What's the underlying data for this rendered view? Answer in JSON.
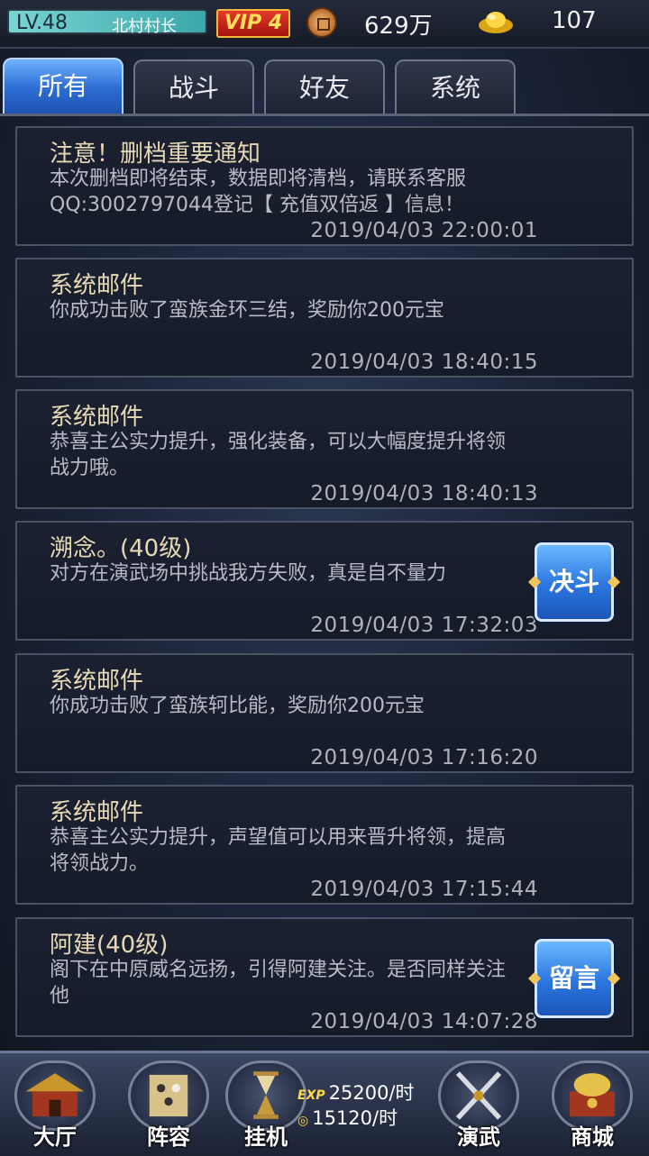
{
  "status_bar": {
    "level": "LV.48",
    "title": "北村村长",
    "vip": "VIP 4",
    "coins": "629万",
    "ingots": "107"
  },
  "tabs": [
    {
      "label": "所有",
      "active": true
    },
    {
      "label": "战斗",
      "active": false
    },
    {
      "label": "好友",
      "active": false
    },
    {
      "label": "系统",
      "active": false
    }
  ],
  "mails": [
    {
      "title": "注意！删档重要通知",
      "body": "本次删档即将结束，数据即将清档，请联系客服QQ:3002797044登记【 充值双倍返 】信息！",
      "time": "2019/04/03  22:00:01",
      "action": ""
    },
    {
      "title": "系统邮件",
      "body": "你成功击败了蛮族金环三结，奖励你200元宝",
      "time": "2019/04/03  18:40:15",
      "action": ""
    },
    {
      "title": "系统邮件",
      "body": "恭喜主公实力提升，强化装备，可以大幅度提升将领战力哦。",
      "time": "2019/04/03  18:40:13",
      "action": ""
    },
    {
      "title": "溯念。(40级)",
      "body": "对方在演武场中挑战我方失败，真是自不量力",
      "time": "2019/04/03  17:32:03",
      "action": "决斗"
    },
    {
      "title": "系统邮件",
      "body": "你成功击败了蛮族轲比能，奖励你200元宝",
      "time": "2019/04/03  17:16:20",
      "action": ""
    },
    {
      "title": "系统邮件",
      "body": "恭喜主公实力提升，声望值可以用来晋升将领，提高将领战力。",
      "time": "2019/04/03  17:15:44",
      "action": ""
    },
    {
      "title": "阿建(40级)",
      "body": "阁下在中原威名远扬，引得阿建关注。是否同样关注他",
      "time": "2019/04/03  14:07:28",
      "action": "留言"
    }
  ],
  "bottom_nav": {
    "items": [
      {
        "label": "大厅",
        "icon": "hall-icon"
      },
      {
        "label": "阵容",
        "icon": "formation-icon"
      },
      {
        "label": "挂机",
        "icon": "hourglass-icon"
      },
      {
        "label": "演武",
        "icon": "crossed-swords-icon"
      },
      {
        "label": "商城",
        "icon": "treasure-chest-icon"
      }
    ],
    "exp_tag": "EXP",
    "exp_rate": "25200/时",
    "coin_rate": "15120/时"
  },
  "colors": {
    "accent_blue": "#2e6fd6",
    "title_text": "#e8d9b6",
    "vip_red": "#c0201a"
  }
}
